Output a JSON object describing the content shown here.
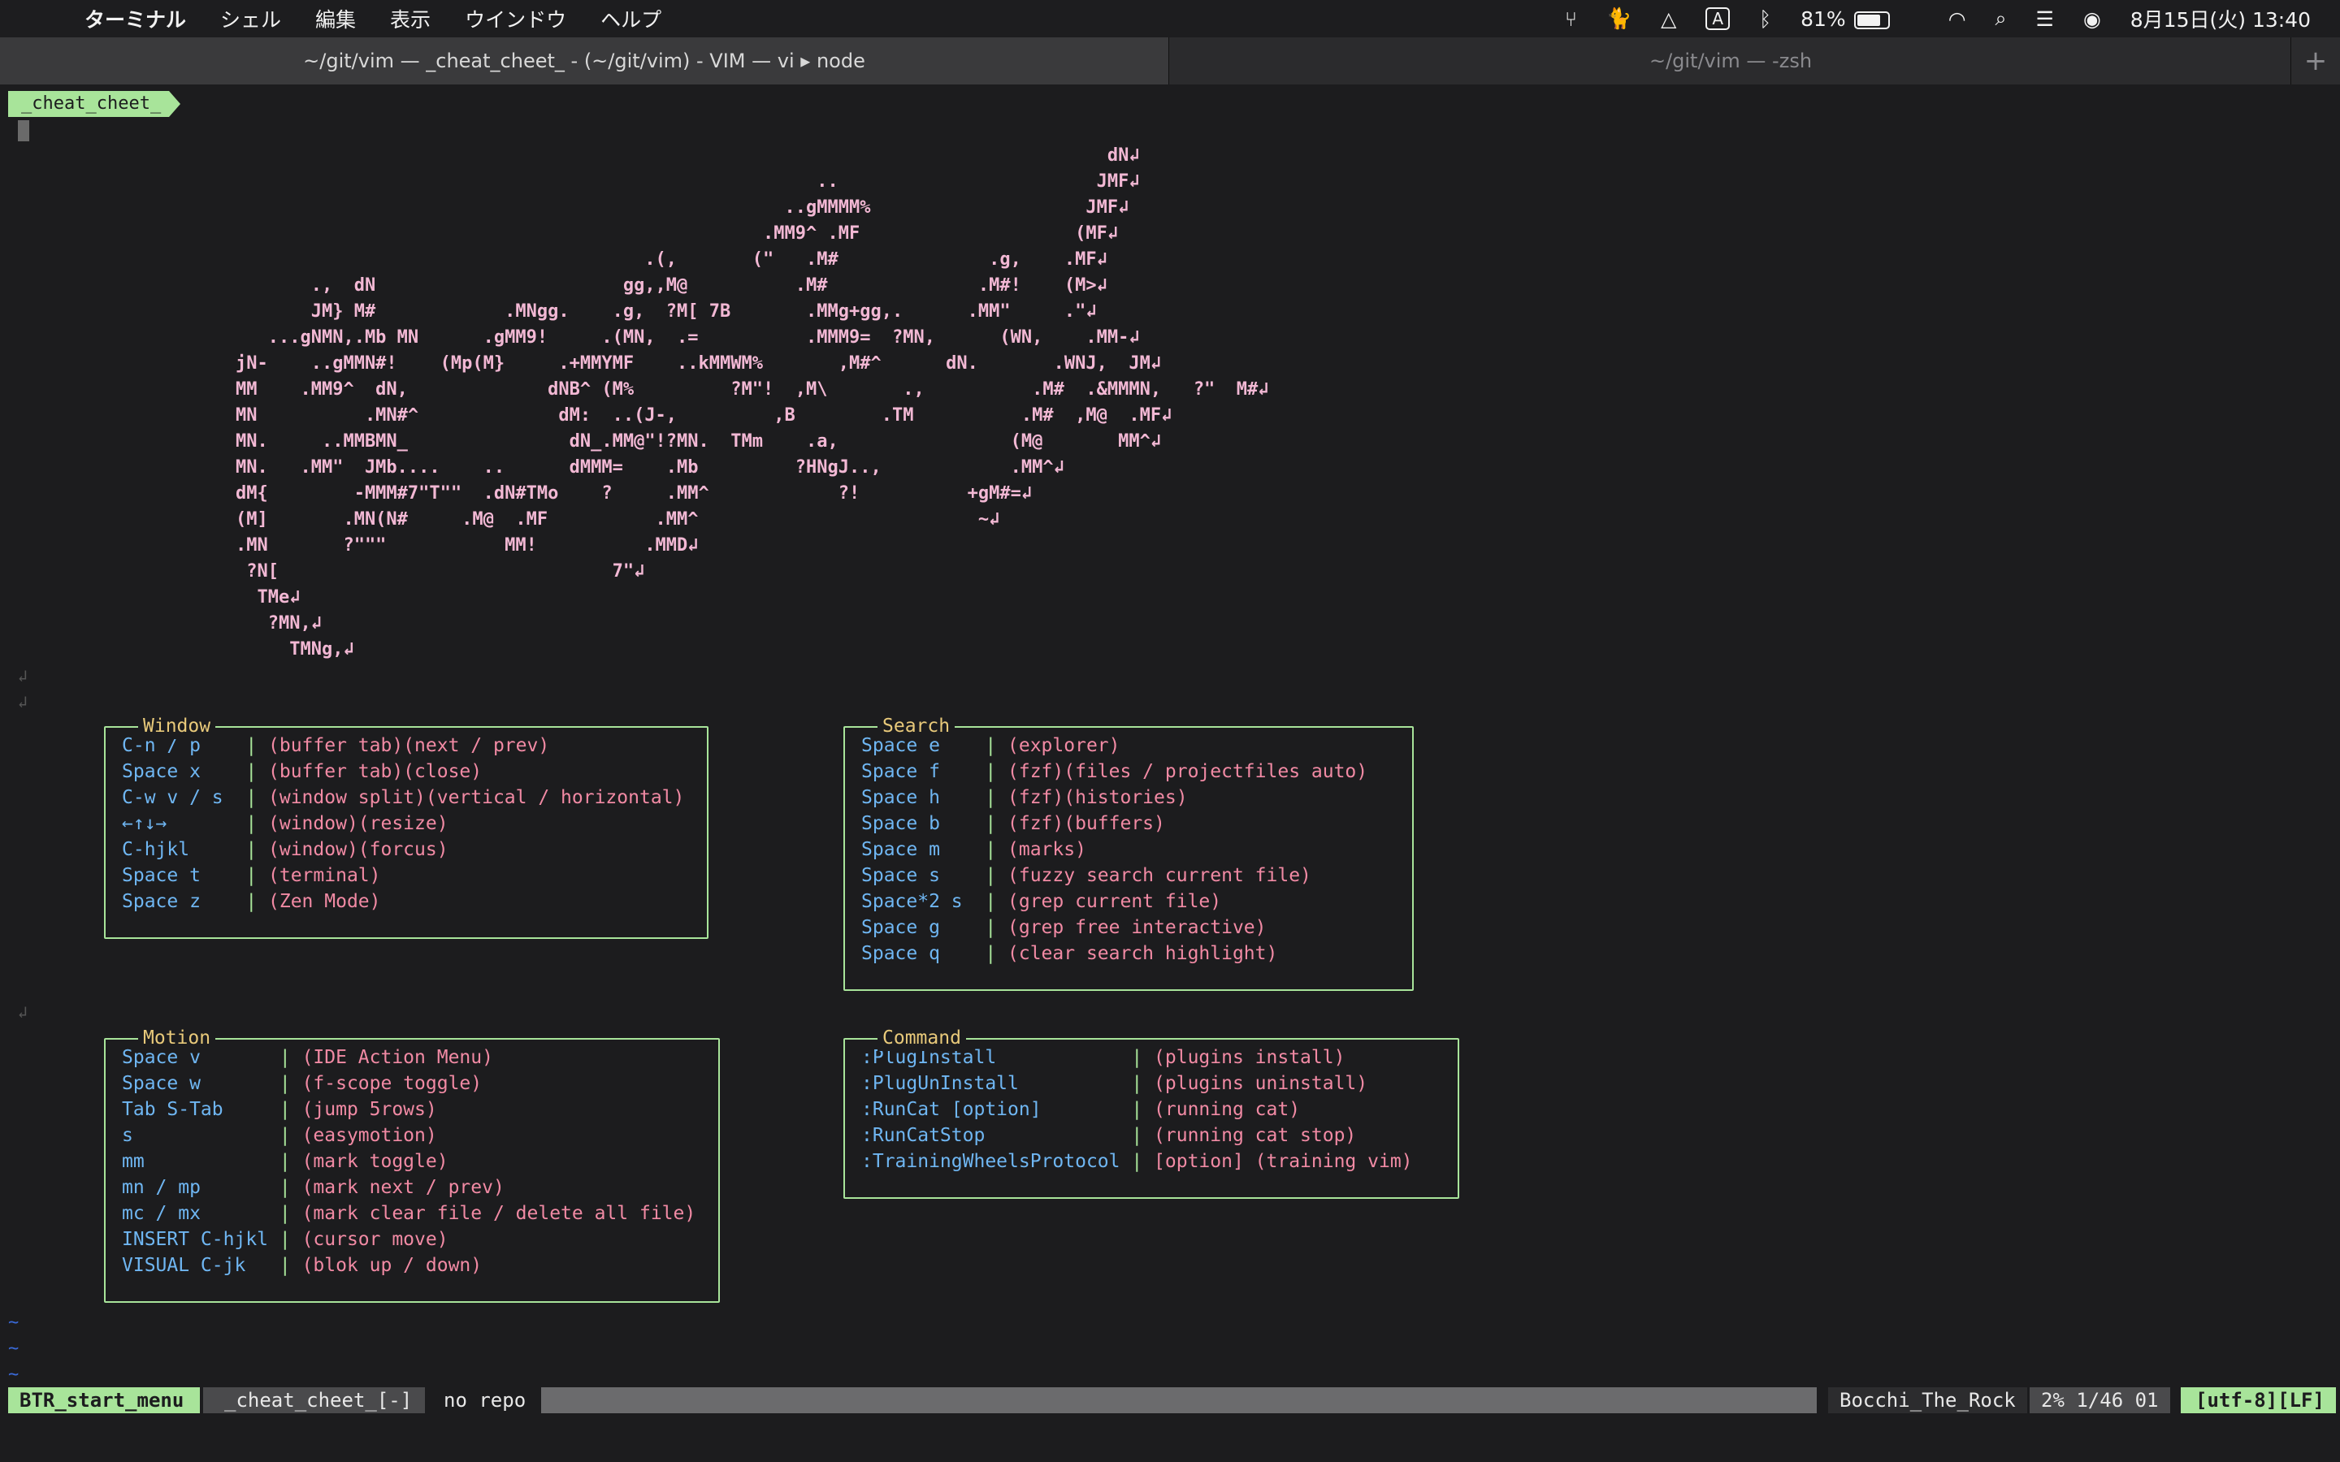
{
  "menubar": {
    "apple": "",
    "app_name": "ターミナル",
    "menus": [
      "シェル",
      "編集",
      "表示",
      "ウインドウ",
      "ヘルプ"
    ],
    "battery": "81%",
    "datetime": "8月15日(火) 13:40",
    "input_mode": "A"
  },
  "tabs": {
    "active": "~/git/vim — _cheat_cheet_ - (~/git/vim) - VIM — vi ▸ node",
    "inactive": "~/git/vim — -zsh",
    "add": "+"
  },
  "vim": {
    "buffer_tab": "_cheat_cheet_",
    "eol_mark": "↲",
    "ascii_art": "                                                                                 dN↲\n                                                      ..                        JMF↲\n                                                   ..gMMMM%                    JMF↲\n                                                 .MM9^ .MF                    (MF↲\n                                      .(,       (\"   .M#              .g,    .MF↲\n       .,  dN                       gg,,M@          .M#              .M#!    (M>↲\n       JM} M#            .MNgg.    .g,  ?M[ 7B       .MMg+gg,.      .MM\"     .\"↲\n   ...gNMN,.Mb MN      .gMM9!     .(MN,  .=          .MMM9=  ?MN,      (WN,    .MM-↲\njN-    ..gMMN#!    (Mp(M}     .+MMYMF    ..kMMWM%       ,M#^      dN.       .WNJ,  JM↲\nMM    .MM9^  dN,             dNB^ (M%         ?M\"!  ,M\\       .,          .M#  .&MMMN,   ?\"  M#↲\nMN          .MN#^             dM:  ..(J-,         ,B        .TM          .M#  ,M@  .MF↲\nMN.     ..MMBMN_               dN_.MM@\"!?MN.  TMm    .a,                (M@       MM^↲\nMN.   .MM\"  JMb....    ..      dMMM=    .Mb         ?HNgJ..,            .MM^↲\ndM{        -MMM#7\"T\"\"  .dN#TMo    ?     .MM^            ?!          +gM#=↲\n(M]       .MN(N#     .M@  .MF          .MM^                          ~↲\n.MN       ?\"\"\"           MM!          .MMD↲\n ?N[                               7\"↲\n  TMe↲\n   ?MN,↲\n     TMNg,↲",
    "boxes": {
      "window": {
        "title": "Window",
        "rows": [
          {
            "key": "C-n / p",
            "desc": "(buffer tab)(next / prev)"
          },
          {
            "key": "Space x",
            "desc": "(buffer tab)(close)"
          },
          {
            "key": "C-w v / s",
            "desc": "(window split)(vertical / horizontal)"
          },
          {
            "key": "←↑↓→",
            "desc": "(window)(resize)"
          },
          {
            "key": "C-hjkl",
            "desc": "(window)(forcus)"
          },
          {
            "key": "Space t",
            "desc": "(terminal)"
          },
          {
            "key": "Space z",
            "desc": "(Zen Mode)"
          }
        ]
      },
      "search": {
        "title": "Search",
        "rows": [
          {
            "key": "Space e",
            "desc": "(explorer)"
          },
          {
            "key": "Space f",
            "desc": "(fzf)(files / projectfiles auto)"
          },
          {
            "key": "Space h",
            "desc": "(fzf)(histories)"
          },
          {
            "key": "Space b",
            "desc": "(fzf)(buffers)"
          },
          {
            "key": "Space m",
            "desc": "(marks)"
          },
          {
            "key": "Space s",
            "desc": "(fuzzy search current file)"
          },
          {
            "key": "Space*2 s",
            "desc": "(grep current file)"
          },
          {
            "key": "Space g",
            "desc": "(grep free interactive)"
          },
          {
            "key": "Space q",
            "desc": "(clear search highlight)"
          }
        ]
      },
      "motion": {
        "title": "Motion",
        "rows": [
          {
            "key": "Space v",
            "desc": "(IDE Action Menu)"
          },
          {
            "key": "Space w",
            "desc": "(f-scope toggle)"
          },
          {
            "key": "Tab S-Tab",
            "desc": "(jump 5rows)"
          },
          {
            "key": "s",
            "desc": "(easymotion)"
          },
          {
            "key": "mm",
            "desc": "(mark toggle)"
          },
          {
            "key": "mn / mp",
            "desc": "(mark next / prev)"
          },
          {
            "key": "mc / mx",
            "desc": "(mark clear file / delete all file)"
          },
          {
            "key": "INSERT C-hjkl",
            "desc": "(cursor move)"
          },
          {
            "key": "VISUAL C-jk",
            "desc": "(blok up / down)"
          }
        ]
      },
      "command": {
        "title": "Command",
        "rows": [
          {
            "key": ":PlugInstall",
            "desc": "(plugins install)"
          },
          {
            "key": ":PlugUnInstall",
            "desc": "(plugins uninstall)"
          },
          {
            "key": ":RunCat [option]",
            "desc": "(running cat)"
          },
          {
            "key": ":RunCatStop",
            "desc": "(running cat stop)"
          },
          {
            "key": ":TrainingWheelsProtocol",
            "desc": "[option] (training vim)"
          }
        ]
      }
    },
    "statusline": {
      "mode": "BTR_start_menu",
      "file": "_cheat_cheet_[-]",
      "repo": "no repo",
      "branch": "Bocchi_The_Rock",
      "position": "2% 1/46 01",
      "encoding": "[utf-8][LF]"
    },
    "tilde": "~"
  },
  "colors": {
    "background": "#1c1c1e",
    "accent_green": "#a8e49a",
    "art_pink": "#f2b8d4",
    "key_blue": "#6fb6f2",
    "desc_pink": "#f18aa4",
    "title_yellow": "#e8c97a"
  }
}
